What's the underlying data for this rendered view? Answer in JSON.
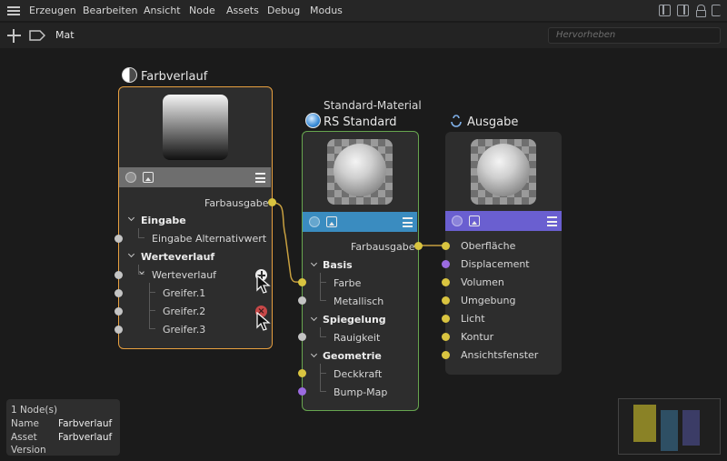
{
  "menubar": {
    "items": [
      "Erzeugen",
      "Bearbeiten",
      "Ansicht",
      "Node",
      "Assets",
      "Debug",
      "Modus"
    ]
  },
  "toolbar": {
    "breadcrumb": "Mat",
    "search_placeholder": "Hervorheben"
  },
  "nodes": {
    "farbverlauf": {
      "title": "Farbverlauf",
      "output": "Farbausgabe",
      "group_input": "Eingabe",
      "input_alt": "Eingabe Alternativwert",
      "group_gradient": "Werteverlauf",
      "gradient": "Werteverlauf",
      "knots": [
        "Greifer.1",
        "Greifer.2",
        "Greifer.3"
      ]
    },
    "standard": {
      "subtitle": "Standard-Material",
      "title": "RS Standard",
      "output": "Farbausgabe",
      "groups": {
        "basis": "Basis",
        "spiegelung": "Spiegelung",
        "geometrie": "Geometrie"
      },
      "ports": {
        "farbe": "Farbe",
        "metallisch": "Metallisch",
        "rauigkeit": "Rauigkeit",
        "deckkraft": "Deckkraft",
        "bump": "Bump-Map"
      }
    },
    "ausgabe": {
      "title": "Ausgabe",
      "ports": [
        "Oberfläche",
        "Displacement",
        "Volumen",
        "Umgebung",
        "Licht",
        "Kontur",
        "Ansichtsfenster"
      ]
    }
  },
  "info_panel": {
    "count": "1 Node(s)",
    "name_label": "Name",
    "name_value": "Farbverlauf",
    "asset_label": "Asset",
    "asset_value": "Farbverlauf",
    "version_label": "Version",
    "version_value": ""
  },
  "colors": {
    "selected_border": "#e8a040",
    "material_border": "#67a54f",
    "port_color": "#d9c440",
    "port_vector": "#9b6be0",
    "port_float": "#c4c4c4",
    "bar_gray": "#6e6e6e",
    "bar_blue": "#3a8cc0",
    "bar_purple": "#6a5fd0",
    "wire": "#c8a040"
  }
}
